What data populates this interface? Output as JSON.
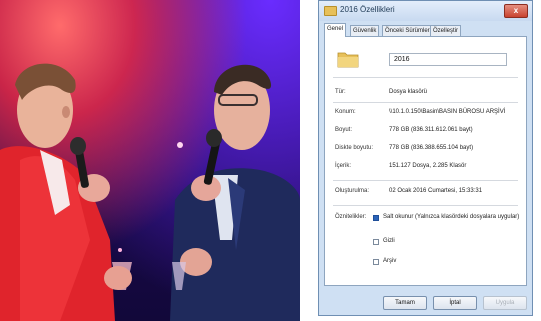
{
  "dialog": {
    "title": "2016 Özellikleri",
    "close_label": "x",
    "tabs": [
      {
        "label": "Genel"
      },
      {
        "label": "Güvenlik"
      },
      {
        "label": "Önceki Sürümler"
      },
      {
        "label": "Özelleştir"
      }
    ],
    "folder_name": "2016",
    "rows": [
      {
        "label": "Tür:",
        "value": "Dosya klasörü"
      },
      {
        "label": "Konum:",
        "value": "\\\\10.1.0.150\\Basin\\BASIN BÜROSU ARŞİVİ"
      },
      {
        "label": "Boyut:",
        "value": "778 GB (836.311.612.061 bayt)"
      },
      {
        "label": "Diskte boyutu:",
        "value": "778 GB (836.388.655.104 bayt)"
      },
      {
        "label": "İçerik:",
        "value": "151.127 Dosya, 2.285 Klasör"
      },
      {
        "label": "Oluşturulma:",
        "value": "02 Ocak 2016 Cumartesi, 15:33:31"
      }
    ],
    "attributes_label": "Öznitelikler:",
    "attributes": [
      {
        "label": "Salt okunur (Yalnızca klasördeki dosyalara uygular)",
        "checked": true
      },
      {
        "label": "Gizli",
        "checked": false
      },
      {
        "label": "Arşiv",
        "checked": false
      }
    ],
    "buttons": {
      "ok": "Tamam",
      "cancel": "İptal",
      "apply": "Uygula"
    }
  },
  "colors": {
    "window_frame": "#cfe0f3",
    "folder_icon": "#e7c05a",
    "jacket_left": "#e0242c",
    "suit_right": "#1f2a5c"
  }
}
